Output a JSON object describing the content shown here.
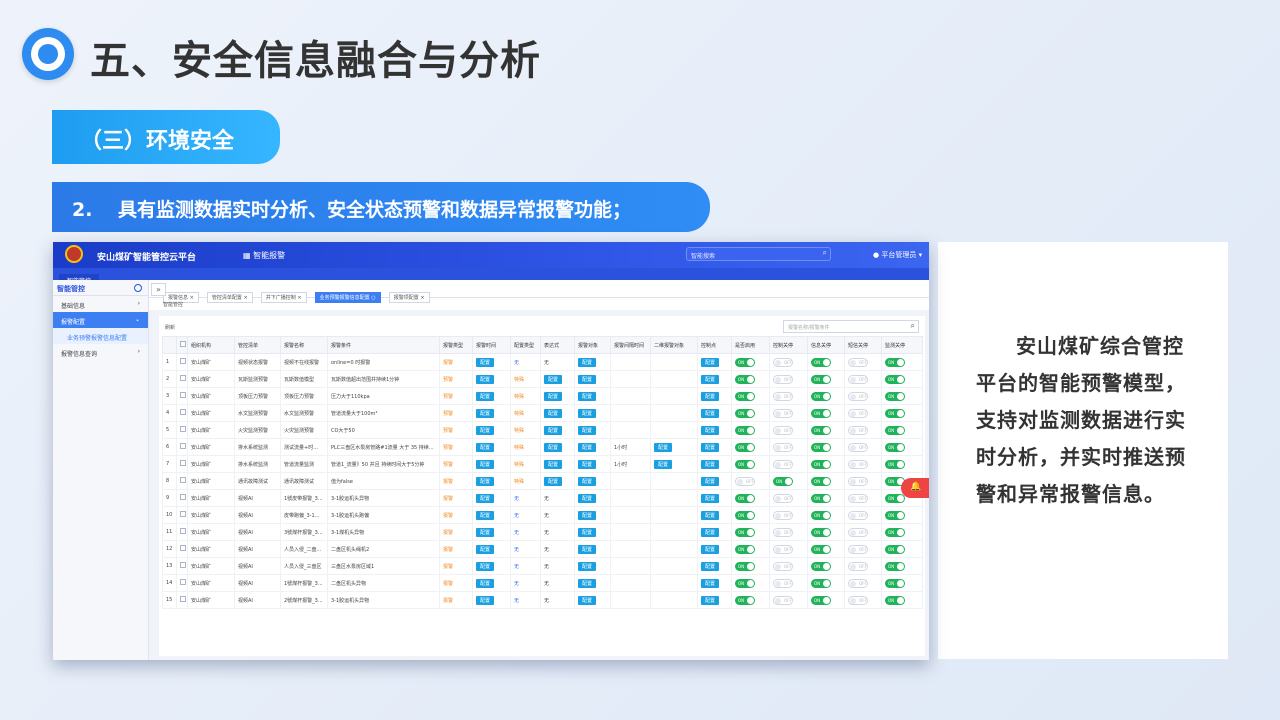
{
  "page": {
    "title": "五、安全信息融合与分析",
    "section": "（三）环境安全",
    "point_num": "2.",
    "point_text": "具有监测数据实时分析、安全状态预警和数据异常报警功能；",
    "description": "安山煤矿综合管控平台的智能预警模型，支持对监测数据进行实时分析，并实时推送预警和异常报警信息。"
  },
  "app": {
    "system_name": "安山煤矿智能管控云平台",
    "nav": "智能报警",
    "search_placeholder": "智能搜索",
    "user": "平台管理员",
    "sub_tab": "智能管控",
    "sidebar": {
      "header": "智能管控",
      "items": [
        {
          "label": "基础信息",
          "state": "normal"
        },
        {
          "label": "报警配置",
          "state": "active"
        },
        {
          "label": "业务预警报警信息配置",
          "state": "sub"
        },
        {
          "label": "报警信息查询",
          "state": "normal"
        }
      ]
    },
    "tabs": [
      "报警信息",
      "管控清单配置",
      "井下广播控制",
      "业务预警报警信息配置",
      "报警项配置"
    ],
    "breadcrumb": "智能管控",
    "back_label": "刷新",
    "filter_placeholder": "报警名称/报警条件",
    "columns": [
      "组织机构",
      "管控清单",
      "报警名称",
      "报警条件",
      "报警类型",
      "报警时间",
      "配置类型",
      "表达式",
      "报警对象",
      "报警间隔时间",
      "二维报警对象",
      "控制点",
      "是否启用",
      "控制关停",
      "信息关停",
      "短信关停",
      "监测关停"
    ],
    "btn_label": "配置",
    "rows": [
      [
        "1",
        "安山煤矿",
        "视频状态报警",
        "视频不在线报警",
        "online=0 时报警",
        "报警",
        "配置",
        "无",
        "无",
        "配置",
        "",
        "",
        "配置",
        "on",
        "off",
        "on",
        "off",
        "on"
      ],
      [
        "2",
        "安山煤矿",
        "瓦斯监测预警",
        "瓦斯数值模型",
        "瓦斯数值超出范围并持续1分钟",
        "预警",
        "配置",
        "特殊",
        "配置",
        "配置",
        "",
        "",
        "配置",
        "on",
        "off",
        "on",
        "off",
        "on"
      ],
      [
        "3",
        "安山煤矿",
        "顶板压力预警",
        "顶板压力预警",
        "压力大于110kpa",
        "预警",
        "配置",
        "特殊",
        "配置",
        "配置",
        "",
        "",
        "配置",
        "on",
        "off",
        "on",
        "off",
        "on"
      ],
      [
        "4",
        "安山煤矿",
        "水文监测预警",
        "水文监测预警",
        "管道流量大于100m³",
        "预警",
        "配置",
        "特殊",
        "配置",
        "配置",
        "",
        "",
        "配置",
        "on",
        "off",
        "on",
        "off",
        "on"
      ],
      [
        "5",
        "安山煤矿",
        "火灾监测预警",
        "火灾监测预警",
        "CO大于50",
        "预警",
        "配置",
        "特殊",
        "配置",
        "配置",
        "",
        "",
        "配置",
        "on",
        "off",
        "on",
        "off",
        "on"
      ],
      [
        "6",
        "安山煤矿",
        "排水系统监测",
        "测试流量+时...",
        "PLC三盘区水泵房管路#1流量 大于 35 持续...",
        "预警",
        "配置",
        "特殊",
        "配置",
        "配置",
        "1小时",
        "配置",
        "配置",
        "on",
        "off",
        "on",
        "off",
        "on"
      ],
      [
        "7",
        "安山煤矿",
        "排水系统监测",
        "管道流量监测",
        "管道1_流量》50 并且 持续时间大于5分钟",
        "预警",
        "配置",
        "特殊",
        "配置",
        "配置",
        "1小时",
        "配置",
        "配置",
        "on",
        "off",
        "on",
        "off",
        "on"
      ],
      [
        "8",
        "安山煤矿",
        "通讯故障测试",
        "通讯故障测试",
        "值为false",
        "报警",
        "配置",
        "特殊",
        "配置",
        "配置",
        "",
        "",
        "配置",
        "off",
        "on",
        "on",
        "off",
        "on"
      ],
      [
        "9",
        "安山煤矿",
        "视频AI",
        "1號皮带报警_3...",
        "3-1胶运机头异物",
        "报警",
        "配置",
        "无",
        "无",
        "配置",
        "",
        "",
        "配置",
        "on",
        "off",
        "on",
        "off",
        "on"
      ],
      [
        "10",
        "安山煤矿",
        "视频AI",
        "皮带跑偏_3-1...",
        "3-1胶运机头跑偏",
        "报警",
        "配置",
        "无",
        "无",
        "配置",
        "",
        "",
        "配置",
        "on",
        "off",
        "on",
        "off",
        "on"
      ],
      [
        "11",
        "安山煤矿",
        "视频AI",
        "3號煤杆报警_3...",
        "3-1煤机头异物",
        "报警",
        "配置",
        "无",
        "无",
        "配置",
        "",
        "",
        "配置",
        "on",
        "off",
        "on",
        "off",
        "on"
      ],
      [
        "12",
        "安山煤矿",
        "视频AI",
        "人员入侵_二盘...",
        "二盘区机头绳机2",
        "报警",
        "配置",
        "无",
        "无",
        "配置",
        "",
        "",
        "配置",
        "on",
        "off",
        "on",
        "off",
        "on"
      ],
      [
        "13",
        "安山煤矿",
        "视频AI",
        "人员入侵_三盘区",
        "三盘区水泵房区域1",
        "报警",
        "配置",
        "无",
        "无",
        "配置",
        "",
        "",
        "配置",
        "on",
        "off",
        "on",
        "off",
        "on"
      ],
      [
        "14",
        "安山煤矿",
        "视频AI",
        "1號煤杆报警_3...",
        "二盘区机头异物",
        "报警",
        "配置",
        "无",
        "无",
        "配置",
        "",
        "",
        "配置",
        "on",
        "off",
        "on",
        "off",
        "on"
      ],
      [
        "15",
        "安山煤矿",
        "视频AI",
        "2號煤杆报警_3...",
        "3-1胶运机头异物",
        "报警",
        "配置",
        "无",
        "无",
        "配置",
        "",
        "",
        "配置",
        "on",
        "off",
        "on",
        "off",
        "on"
      ]
    ]
  }
}
